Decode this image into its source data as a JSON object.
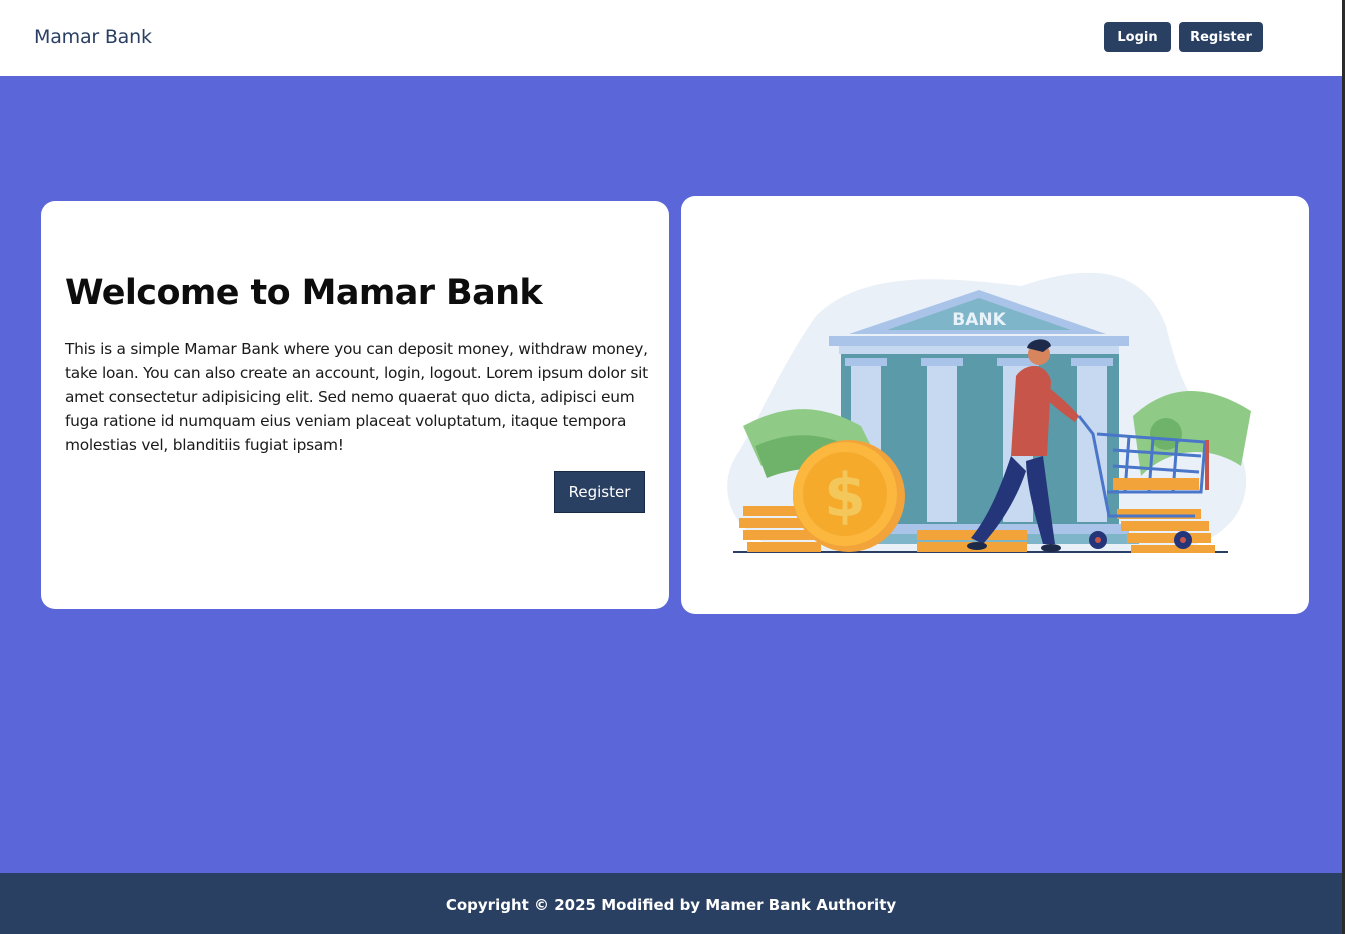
{
  "navbar": {
    "brand": "Mamar Bank",
    "login_label": "Login",
    "register_label": "Register"
  },
  "hero": {
    "title": "Welcome to Mamar Bank",
    "description": "This is a simple Mamar Bank where you can deposit money, withdraw money, take loan. You can also create an account, login, logout. Lorem ipsum dolor sit amet consectetur adipisicing elit. Sed nemo quaerat quo dicta, adipisci eum fuga ratione id numquam eius veniam placeat voluptatum, itaque tempora molestias vel, blanditiis fugiat ipsam!",
    "register_label": "Register"
  },
  "illustration": {
    "icon": "bank-shopping-illustration",
    "bank_sign": "BANK",
    "coin_symbol": "$"
  },
  "footer": {
    "copyright": "Copyright © 2025 Modified by Mamer Bank Authority"
  },
  "colors": {
    "primary": "#2a4063",
    "hero_background": "#5b67d8",
    "card_background": "#ffffff"
  }
}
